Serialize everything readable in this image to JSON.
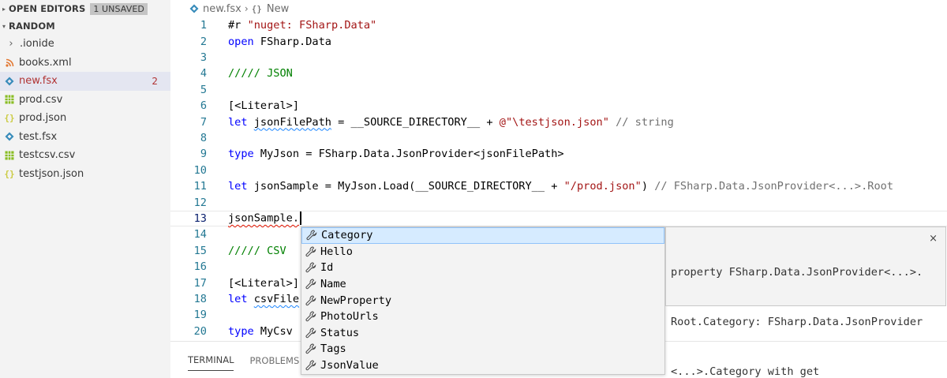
{
  "sidebar": {
    "open_editors": {
      "title": "OPEN EDITORS",
      "badge": "1 UNSAVED"
    },
    "folder": {
      "title": "RANDOM"
    },
    "items": [
      {
        "label": ".ionide",
        "icon": "chevron-right-icon",
        "kind": "folder"
      },
      {
        "label": "books.xml",
        "icon": "rss-icon",
        "color": "#e37933"
      },
      {
        "label": "new.fsx",
        "icon": "fsharp-diamond-icon",
        "color": "#378bba",
        "count": "2",
        "active": true
      },
      {
        "label": "prod.csv",
        "icon": "table-icon",
        "color": "#89bd23"
      },
      {
        "label": "prod.json",
        "icon": "braces-icon",
        "color": "#cbcb41"
      },
      {
        "label": "test.fsx",
        "icon": "fsharp-diamond-icon",
        "color": "#378bba"
      },
      {
        "label": "testcsv.csv",
        "icon": "table-icon",
        "color": "#89bd23"
      },
      {
        "label": "testjson.json",
        "icon": "braces-icon",
        "color": "#cbcb41"
      }
    ]
  },
  "breadcrumb": {
    "file": "new.fsx",
    "ns_icon": "{}",
    "symbol": "New"
  },
  "editor": {
    "line_numbers": [
      "1",
      "2",
      "3",
      "4",
      "5",
      "6",
      "7",
      "8",
      "9",
      "10",
      "11",
      "12",
      "13",
      "14",
      "15",
      "16",
      "17",
      "18",
      "19",
      "20"
    ],
    "current_line": "13"
  },
  "panel": {
    "tabs": [
      "TERMINAL",
      "PROBLEMS"
    ]
  },
  "suggest": {
    "items": [
      "Category",
      "Hello",
      "Id",
      "Name",
      "NewProperty",
      "PhotoUrls",
      "Status",
      "Tags",
      "JsonValue"
    ],
    "icon": "wrench-icon",
    "details": [
      "property FSharp.Data.JsonProvider<...>.",
      "Root.Category: FSharp.Data.JsonProvider",
      "<...>.Category with get"
    ],
    "close": "×"
  },
  "colors": {
    "keyword": "#0000ff",
    "string": "#a31515",
    "comment": "#008000",
    "line_number": "#237893",
    "accent": "#90c2f9"
  }
}
